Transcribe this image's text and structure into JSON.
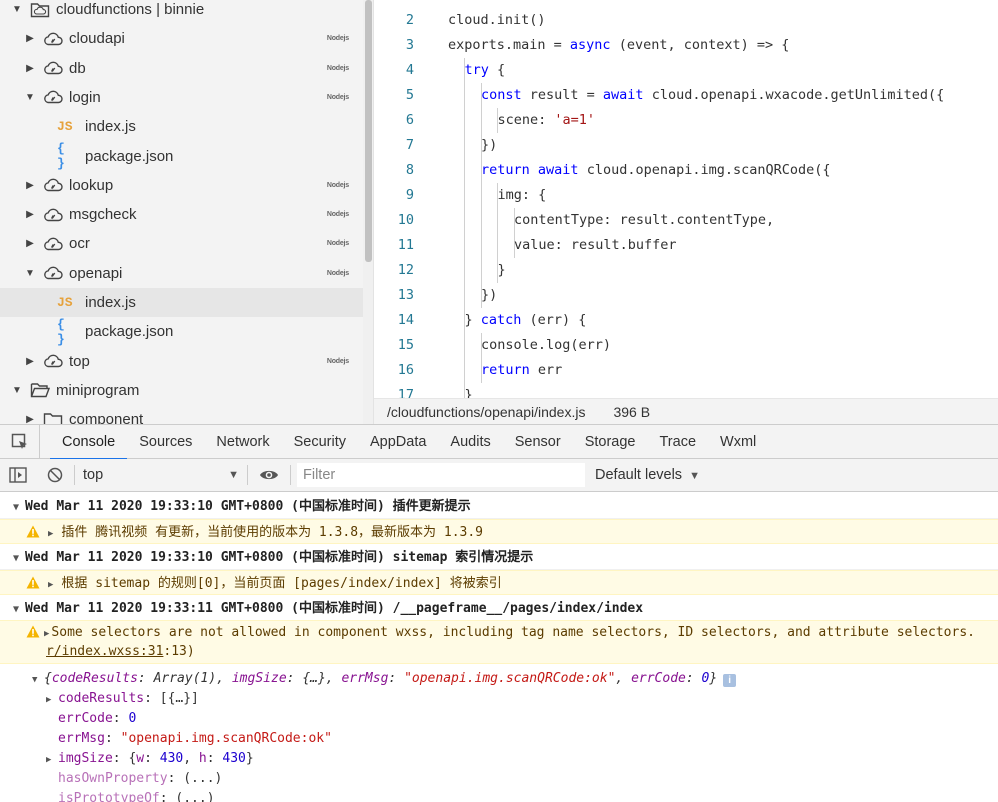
{
  "tree": {
    "items": [
      {
        "type": "folder-cloud-root",
        "label": "cloudfunctions | binnie",
        "expanded": true,
        "depth": 0
      },
      {
        "type": "cloud",
        "label": "cloudapi",
        "expanded": false,
        "depth": 1,
        "tag": "Nodejs"
      },
      {
        "type": "cloud",
        "label": "db",
        "expanded": false,
        "depth": 1,
        "tag": "Nodejs"
      },
      {
        "type": "cloud",
        "label": "login",
        "expanded": true,
        "depth": 1,
        "tag": "Nodejs"
      },
      {
        "type": "js",
        "label": "index.js",
        "depth": 2
      },
      {
        "type": "json",
        "label": "package.json",
        "depth": 2
      },
      {
        "type": "cloud",
        "label": "lookup",
        "expanded": false,
        "depth": 1,
        "tag": "Nodejs"
      },
      {
        "type": "cloud",
        "label": "msgcheck",
        "expanded": false,
        "depth": 1,
        "tag": "Nodejs"
      },
      {
        "type": "cloud",
        "label": "ocr",
        "expanded": false,
        "depth": 1,
        "tag": "Nodejs"
      },
      {
        "type": "cloud",
        "label": "openapi",
        "expanded": true,
        "depth": 1,
        "tag": "Nodejs"
      },
      {
        "type": "js",
        "label": "index.js",
        "depth": 2,
        "selected": true
      },
      {
        "type": "json",
        "label": "package.json",
        "depth": 2
      },
      {
        "type": "cloud",
        "label": "top",
        "expanded": false,
        "depth": 1,
        "tag": "Nodejs"
      },
      {
        "type": "folder",
        "label": "miniprogram",
        "expanded": true,
        "depth": 0
      },
      {
        "type": "folder",
        "label": "component",
        "expanded": false,
        "depth": 1
      }
    ],
    "js_glyph": "JS",
    "json_glyph": "{ }"
  },
  "editor": {
    "lines": [
      {
        "n": "2",
        "indent": 0,
        "tokens": [
          [
            "t",
            "cloud.init()"
          ]
        ]
      },
      {
        "n": "3",
        "indent": 0,
        "tokens": [
          [
            "t",
            "exports.main = "
          ],
          [
            "k",
            "async"
          ],
          [
            "t",
            " (event, context) => {"
          ]
        ]
      },
      {
        "n": "4",
        "indent": 1,
        "tokens": [
          [
            "k",
            "try"
          ],
          [
            "t",
            " {"
          ]
        ]
      },
      {
        "n": "5",
        "indent": 2,
        "tokens": [
          [
            "k",
            "const"
          ],
          [
            "t",
            " result = "
          ],
          [
            "k",
            "await"
          ],
          [
            "t",
            " cloud.openapi.wxacode.getUnlimited({"
          ]
        ]
      },
      {
        "n": "6",
        "indent": 3,
        "tokens": [
          [
            "t",
            "scene: "
          ],
          [
            "s",
            "'a=1'"
          ]
        ]
      },
      {
        "n": "7",
        "indent": 2,
        "tokens": [
          [
            "t",
            "})"
          ]
        ]
      },
      {
        "n": "8",
        "indent": 2,
        "tokens": [
          [
            "k",
            "return"
          ],
          [
            "t",
            " "
          ],
          [
            "k",
            "await"
          ],
          [
            "t",
            " cloud.openapi.img.scanQRCode({"
          ]
        ]
      },
      {
        "n": "9",
        "indent": 3,
        "tokens": [
          [
            "t",
            "img: {"
          ]
        ]
      },
      {
        "n": "10",
        "indent": 4,
        "tokens": [
          [
            "t",
            "contentType: result.contentType,"
          ]
        ]
      },
      {
        "n": "11",
        "indent": 4,
        "tokens": [
          [
            "t",
            "value: result.buffer"
          ]
        ]
      },
      {
        "n": "12",
        "indent": 3,
        "tokens": [
          [
            "t",
            "}"
          ]
        ]
      },
      {
        "n": "13",
        "indent": 2,
        "tokens": [
          [
            "t",
            "})"
          ]
        ]
      },
      {
        "n": "14",
        "indent": 1,
        "tokens": [
          [
            "t",
            "} "
          ],
          [
            "k",
            "catch"
          ],
          [
            "t",
            " (err) {"
          ]
        ]
      },
      {
        "n": "15",
        "indent": 2,
        "tokens": [
          [
            "t",
            "console.log(err)"
          ]
        ]
      },
      {
        "n": "16",
        "indent": 2,
        "tokens": [
          [
            "k",
            "return"
          ],
          [
            "t",
            " err"
          ]
        ]
      },
      {
        "n": "17",
        "indent": 1,
        "tokens": [
          [
            "t",
            "}"
          ]
        ]
      }
    ]
  },
  "status": {
    "path": "/cloudfunctions/openapi/index.js",
    "size": "396 B"
  },
  "devtools": {
    "tabs": [
      "Console",
      "Sources",
      "Network",
      "Security",
      "AppData",
      "Audits",
      "Sensor",
      "Storage",
      "Trace",
      "Wxml"
    ],
    "active_tab": "Console"
  },
  "console_toolbar": {
    "context": "top",
    "filter_placeholder": "Filter",
    "levels": "Default levels"
  },
  "console": {
    "group1": "Wed Mar 11 2020 19:33:10 GMT+0800 (中国标准时间) 插件更新提示",
    "warn1": "插件 腾讯视频 有更新，当前使用的版本为 1.3.8，最新版本为 1.3.9",
    "group2": "Wed Mar 11 2020 19:33:10 GMT+0800 (中国标准时间) sitemap 索引情况提示",
    "warn2": "根据 sitemap 的规则[0]，当前页面 [pages/index/index] 将被索引",
    "group3": "Wed Mar 11 2020 19:33:11 GMT+0800 (中国标准时间) /__pageframe__/pages/index/index",
    "warn3_line1": "Some selectors are not allowed in component wxss, including tag name selectors, ID selectors, and attribute selectors.",
    "warn3_link": "r/index.wxss:31",
    "warn3_line2_tail": ":13)",
    "obj": {
      "summary_open": "{",
      "summary_codeResults_key": "codeResults",
      "summary_codeResults_val": "Array(1)",
      "summary_imgSize_key": "imgSize",
      "summary_imgSize_val": "{…}",
      "summary_errMsg_key": "errMsg",
      "summary_errMsg_val": "\"openapi.img.scanQRCode:ok\"",
      "summary_errCode_key": "errCode",
      "summary_errCode_val": "0",
      "summary_close": "}",
      "info_glyph": "i",
      "codeResults_key": "codeResults",
      "codeResults_val": "[{…}]",
      "errCode_key": "errCode",
      "errCode_val": "0",
      "errMsg_key": "errMsg",
      "errMsg_val": "\"openapi.img.scanQRCode:ok\"",
      "imgSize_key": "imgSize",
      "imgSize_w": "430",
      "imgSize_h": "430",
      "hasOwnProperty_key": "hasOwnProperty",
      "hasOwnProperty_val": "(...)",
      "isPrototypeOf_key": "isPrototypeOf",
      "isPrototypeOf_val": "(...)"
    }
  },
  "colors": {
    "accent": "#1a73e8",
    "warn_bg": "#fffbe5",
    "keyword": "#0000ff",
    "string": "#a31515",
    "line_number": "#237893"
  }
}
